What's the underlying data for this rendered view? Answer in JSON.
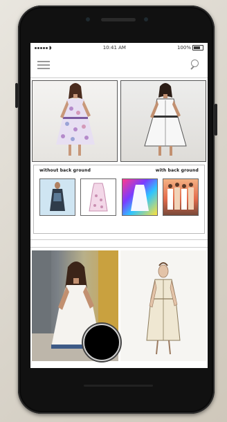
{
  "status": {
    "time": "10:41 AM",
    "battery": "100%"
  },
  "panel": {
    "label_left": "without back ground",
    "label_right": "with back ground"
  },
  "icons": {
    "menu": "hamburger-menu-icon",
    "search": "search-icon"
  },
  "colors": {
    "fab": "#000000",
    "frame": "#111111",
    "accent_purple": "#b58acb"
  }
}
